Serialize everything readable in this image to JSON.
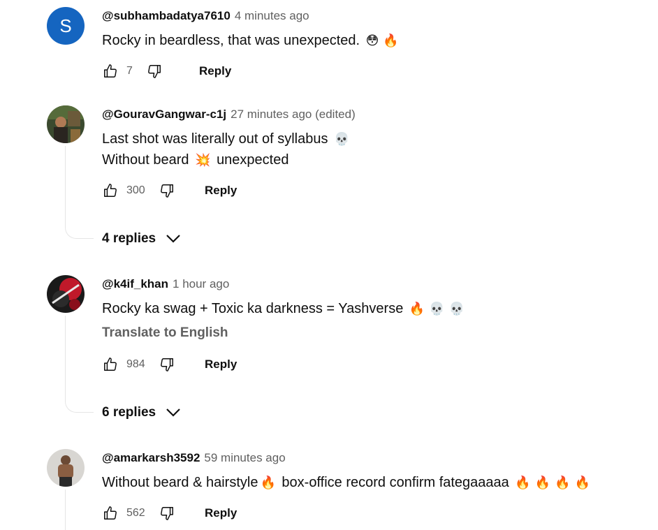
{
  "comments": [
    {
      "author": "@subhambadatya7610",
      "time": "4 minutes ago",
      "avatar_letter": "S",
      "lines": [
        "Rocky in beardless, that was unexpected."
      ],
      "emojis": [
        "😳",
        "🔥"
      ],
      "likes": "7",
      "reply_label": "Reply"
    },
    {
      "author": "@GouravGangwar-c1j",
      "time": "27 minutes ago (edited)",
      "lines": [
        "Last shot was literally out of syllabus",
        "Without beard",
        "unexpected"
      ],
      "emojis": [
        "💀",
        "💥"
      ],
      "likes": "300",
      "reply_label": "Reply",
      "replies_label": "4 replies"
    },
    {
      "author": "@k4if_khan",
      "time": "1 hour ago",
      "lines": [
        "Rocky ka swag + Toxic ka darkness = Yashverse"
      ],
      "emojis": [
        "🔥",
        "💀",
        "💀"
      ],
      "translate_label": "Translate to English",
      "likes": "984",
      "reply_label": "Reply",
      "replies_label": "6 replies"
    },
    {
      "author": "@amarkarsh3592",
      "time": "59 minutes ago",
      "lines": [
        "Without beard & hairstyle",
        "box-office record confirm fategaaaaa"
      ],
      "emojis": [
        "🔥",
        "🔥",
        "🔥",
        "🔥",
        "🔥"
      ],
      "likes": "562",
      "reply_label": "Reply"
    }
  ]
}
